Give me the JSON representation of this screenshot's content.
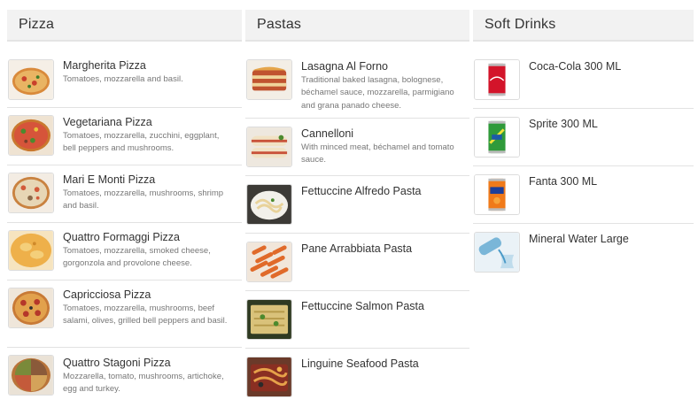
{
  "categories": {
    "pizza": {
      "title": "Pizza",
      "items": [
        {
          "name": "Margherita Pizza",
          "desc": "Tomatoes, mozzarella and basil.",
          "icon": "margherita-pizza-image"
        },
        {
          "name": "Vegetariana Pizza",
          "desc": "Tomatoes, mozzarella, zucchini, eggplant, bell peppers and mushrooms.",
          "icon": "vegetariana-pizza-image"
        },
        {
          "name": "Mari E Monti Pizza",
          "desc": "Tomatoes, mozzarella, mushrooms, shrimp and basil.",
          "icon": "mari-e-monti-pizza-image"
        },
        {
          "name": "Quattro Formaggi Pizza",
          "desc": "Tomatoes, mozzarella, smoked cheese, gorgonzola and provolone cheese.",
          "icon": "quattro-formaggi-pizza-image"
        },
        {
          "name": "Capricciosa Pizza",
          "desc": "Tomatoes, mozzarella, mushrooms, beef salami, olives, grilled bell peppers and basil.",
          "icon": "capricciosa-pizza-image"
        },
        {
          "name": "Quattro Stagoni Pizza",
          "desc": "Mozzarella, tomato, mushrooms, artichoke, egg and turkey.",
          "icon": "quattro-stagoni-pizza-image"
        }
      ]
    },
    "pastas": {
      "title": "Pastas",
      "items": [
        {
          "name": "Lasagna Al Forno",
          "desc": "Traditional baked lasagna, bolognese, béchamel sauce, mozzarella, parmigiano and grana panado cheese.",
          "icon": "lasagna-image"
        },
        {
          "name": "Cannelloni",
          "desc": "With minced meat, béchamel and tomato sauce.",
          "icon": "cannelloni-image"
        },
        {
          "name": "Fettuccine Alfredo Pasta",
          "desc": "",
          "icon": "fettuccine-alfredo-image"
        },
        {
          "name": "Pane Arrabbiata Pasta",
          "desc": "",
          "icon": "arrabbiata-pasta-image"
        },
        {
          "name": "Fettuccine Salmon Pasta",
          "desc": "",
          "icon": "salmon-pasta-image"
        },
        {
          "name": "Linguine Seafood Pasta",
          "desc": "",
          "icon": "seafood-pasta-image"
        }
      ]
    },
    "drinks": {
      "title": "Soft Drinks",
      "items": [
        {
          "name": "Coca-Cola 300 ML",
          "desc": "",
          "icon": "coca-cola-can-image"
        },
        {
          "name": "Sprite 300 ML",
          "desc": "",
          "icon": "sprite-can-image"
        },
        {
          "name": "Fanta 300 ML",
          "desc": "",
          "icon": "fanta-can-image"
        },
        {
          "name": "Mineral Water Large",
          "desc": "",
          "icon": "mineral-water-image"
        }
      ]
    }
  }
}
